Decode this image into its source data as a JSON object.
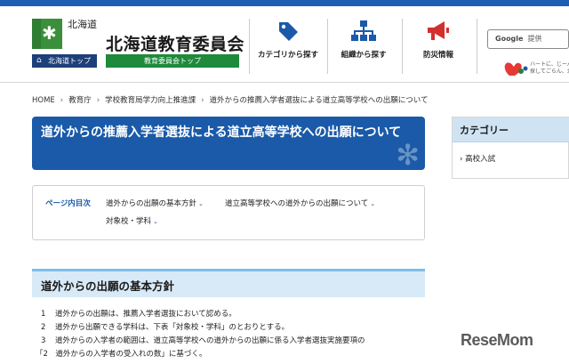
{
  "header": {
    "pref_label": "北海道",
    "hokkaido_top": "北海道トップ",
    "site_title": "北海道教育委員会",
    "board_top": "教育委員会トップ",
    "nav": [
      {
        "label": "カテゴリから探す",
        "icon": "tag-icon"
      },
      {
        "label": "組織から探す",
        "icon": "org-chart-icon"
      },
      {
        "label": "防災情報",
        "icon": "megaphone-icon"
      }
    ],
    "search": {
      "brand": "Google",
      "placeholder": "提供"
    },
    "heart_text_1": "ハートに、じーん",
    "heart_text_2": "探してごらん、北",
    "colors": {
      "topbar": "#1f5fb3",
      "nav_icon": "#1a5aa8",
      "disaster_icon": "#d32f2f",
      "board_green": "#1e8a3a"
    }
  },
  "breadcrumb": [
    "HOME",
    "教育庁",
    "学校教育局学力向上推進課",
    "道外からの推薦入学者選抜による道立高等学校への出願について"
  ],
  "main": {
    "title": "道外からの推薦入学者選抜による道立高等学校への出願について",
    "toc": {
      "label": "ページ内目次",
      "links": [
        "道外からの出願の基本方針",
        "道立高等学校への道外からの出願について",
        "対象校・学科"
      ]
    },
    "section_title": "道外からの出願の基本方針",
    "lines": [
      {
        "num": "1",
        "text": "道外からの出願は、推薦入学者選抜において認める。"
      },
      {
        "num": "2",
        "text": "道外から出願できる学科は、下表「対象校・学科」のとおりとする。"
      },
      {
        "num": "3",
        "text": "道外からの入学者の範囲は、道立高等学校への道外からの出願に係る入学者選抜実施要項の"
      },
      {
        "num": "",
        "text": "「2　道外からの入学者の受入れの数」に基づく。"
      }
    ]
  },
  "sidebar": {
    "heading": "カテゴリー",
    "items": [
      "高校入試"
    ]
  },
  "watermark": "ReseMom"
}
